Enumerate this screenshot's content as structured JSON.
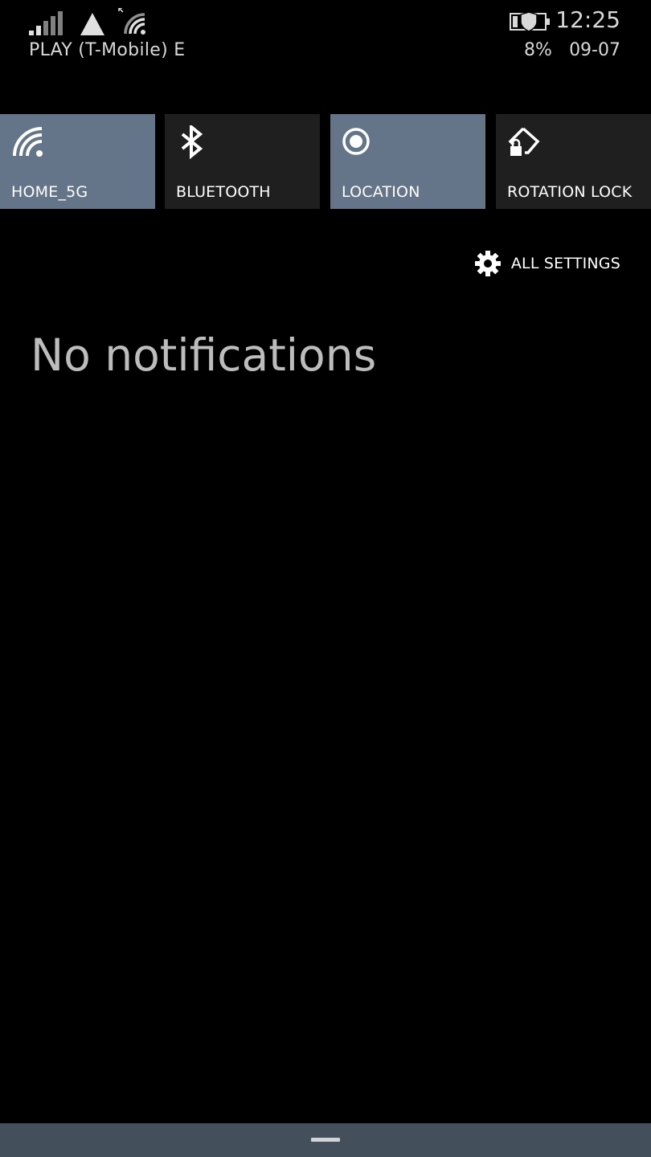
{
  "status_bar": {
    "carrier": "PLAY (T-Mobile) E",
    "time": "12:25",
    "battery_percent": "8%",
    "date": "09-07",
    "icons": [
      "signal-strength-icon",
      "network-triangle-icon",
      "wifi-icon",
      "battery-saver-icon"
    ]
  },
  "quick_actions": [
    {
      "label": "HOME_5G",
      "icon": "wifi-icon",
      "active": true
    },
    {
      "label": "BLUETOOTH",
      "icon": "bluetooth-icon",
      "active": false
    },
    {
      "label": "LOCATION",
      "icon": "location-icon",
      "active": true
    },
    {
      "label": "ROTATION LOCK",
      "icon": "rotation-lock-icon",
      "active": false
    }
  ],
  "all_settings": {
    "label": "ALL SETTINGS",
    "icon": "gear-icon"
  },
  "notifications": {
    "empty_text": "No notifications"
  },
  "colors": {
    "background": "#000000",
    "tile_active": "#647489",
    "tile_inactive": "#1f1f1f",
    "bottom_bar": "#434f5b"
  }
}
